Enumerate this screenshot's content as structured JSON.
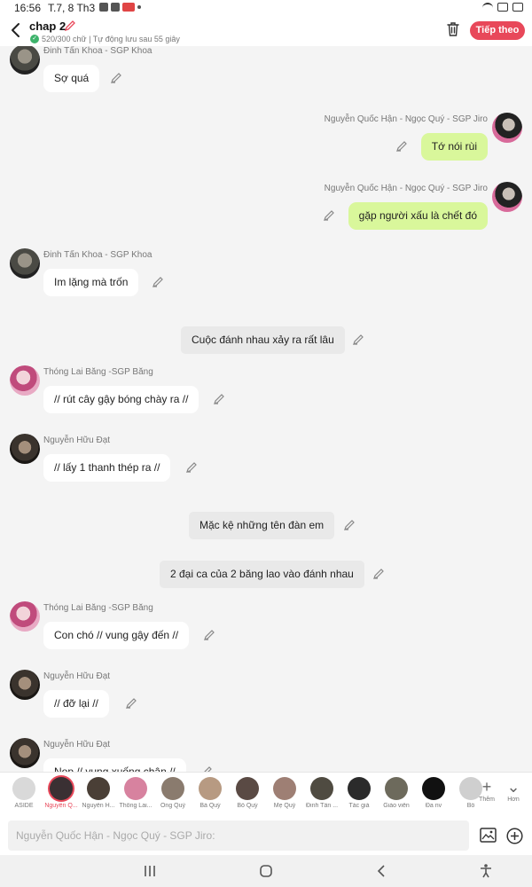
{
  "status_bar": {
    "time": "16:56",
    "date": "T.7, 8 Th3"
  },
  "header": {
    "title": "chap 2",
    "subtitle": "520/300 chữ | Tự động lưu sau 55 giây",
    "next_label": "Tiếp theo",
    "icons": [
      "back-icon",
      "pencil-icon",
      "check-icon",
      "trash-icon"
    ]
  },
  "messages": [
    {
      "kind": "left",
      "sender": "Đinh Tấn Khoa - SGP Khoa",
      "text": "Sợ quá",
      "avatar": "a1"
    },
    {
      "kind": "right",
      "sender": "Nguyễn Quốc Hận - Ngọc Quý - SGP Jiro",
      "text": "Tớ nói rùi",
      "avatar": "a2"
    },
    {
      "kind": "right",
      "sender": "Nguyễn Quốc Hận - Ngọc Quý - SGP Jiro",
      "text": "gặp người xấu là chết đó",
      "avatar": "a2"
    },
    {
      "kind": "left",
      "sender": "Đinh Tấn Khoa - SGP Khoa",
      "text": "Im lặng mà trốn",
      "avatar": "a1"
    },
    {
      "kind": "narration",
      "text": "Cuộc đánh nhau xảy ra rất lâu"
    },
    {
      "kind": "left",
      "sender": "Thóng Lai Băng -SGP Băng",
      "text": "// rút cây gậy bóng chày ra //",
      "avatar": "a3"
    },
    {
      "kind": "left",
      "sender": "Nguyễn Hữu Đạt",
      "text": "// lấy 1 thanh thép ra //",
      "avatar": "a4"
    },
    {
      "kind": "narration",
      "text": "Mặc kệ những tên đàn em"
    },
    {
      "kind": "narration",
      "text": "2 đại ca của 2 băng lao vào đánh nhau"
    },
    {
      "kind": "left",
      "sender": "Thóng Lai Băng -SGP Băng",
      "text": "Con chó // vung gậy đến //",
      "avatar": "a3"
    },
    {
      "kind": "left",
      "sender": "Nguyễn Hữu Đạt",
      "text": "// đỡ lại //",
      "avatar": "a4"
    },
    {
      "kind": "left",
      "sender": "Nguyễn Hữu Đạt",
      "text": "Nọp // vung xuống chân //",
      "avatar": "a4"
    }
  ],
  "cast": [
    {
      "label": "ASIDE",
      "color": "#d9d9d9"
    },
    {
      "label": "Nguyễn Q...",
      "color": "#3a3033",
      "active": true
    },
    {
      "label": "Nguyễn H...",
      "color": "#4a3f36"
    },
    {
      "label": "Thông Lai...",
      "color": "#d7829f"
    },
    {
      "label": "Ông Quý",
      "color": "#8a7b6e"
    },
    {
      "label": "Bà Quý",
      "color": "#b79a82"
    },
    {
      "label": "Bố Quý",
      "color": "#5a4a44"
    },
    {
      "label": "Mẹ Quý",
      "color": "#9e7f74"
    },
    {
      "label": "Đinh Tấn ...",
      "color": "#4f4b41"
    },
    {
      "label": "Tác giả",
      "color": "#2b2b2b"
    },
    {
      "label": "Giáo viên",
      "color": "#6d6a5c"
    },
    {
      "label": "Đa nv",
      "color": "#111111"
    },
    {
      "label": "Bồ",
      "color": "#cfcfcf"
    }
  ],
  "cast_controls": {
    "add_label": "Thêm",
    "more_label": "Hơn"
  },
  "composer": {
    "placeholder": "Nguyễn Quốc Hận - Ngọc Quý - SGP Jiro:"
  },
  "colors": {
    "accent": "#e8485a",
    "mine_bubble": "#d9f79b",
    "narration_bubble": "#e9e9e9"
  }
}
